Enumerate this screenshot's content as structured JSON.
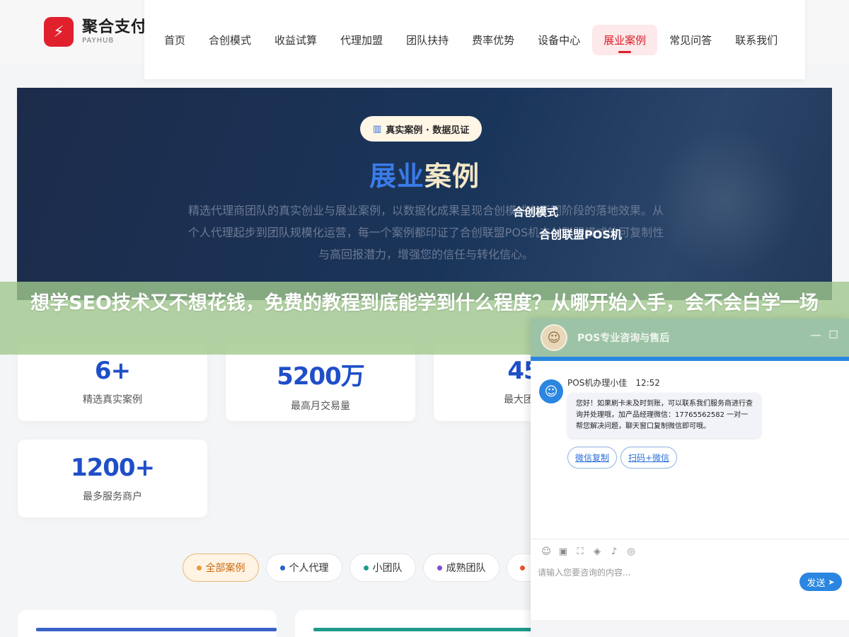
{
  "brand": {
    "name_cn": "聚合支付",
    "name_en": "PAYHUB",
    "logo_glyph": "⚡",
    "color": "#e0202d"
  },
  "nav": {
    "items": [
      {
        "label": "首页"
      },
      {
        "label": "合创模式"
      },
      {
        "label": "收益试算"
      },
      {
        "label": "代理加盟"
      },
      {
        "label": "团队扶持"
      },
      {
        "label": "费率优势"
      },
      {
        "label": "设备中心"
      },
      {
        "label": "展业案例",
        "active": true
      },
      {
        "label": "常见问答"
      },
      {
        "label": "联系我们"
      }
    ]
  },
  "hero": {
    "badge_icon": "chart-icon",
    "badge": "真实案例 · 数据见证",
    "title_part1": "展业",
    "title_part2": "案例",
    "desc": "精选代理商团队的真实创业与展业案例，以数据化成果呈现合创模式在不同阶段的落地效果。从个人代理起步到团队规模化运营，每一个案例都印证了合创联盟POS机支付联盟模式的可复制性与高回报潜力，增强您的信任与转化信心。",
    "tip1": "合创模式",
    "tip2": "合创联盟POS机"
  },
  "overlay": {
    "title": "想学SEO技术又不想花钱，免费的教程到底能学到什么程度？从哪开始入手，会不会白学一场"
  },
  "stats": [
    {
      "value": "6+",
      "label": "精选真实案例"
    },
    {
      "value": "5200万",
      "label": "最高月交易量"
    },
    {
      "value": "45",
      "label": "最大团队"
    },
    {
      "value": "1200+",
      "label": "最多服务商户"
    }
  ],
  "filters": [
    {
      "label": "全部案例",
      "active": true,
      "dot": "#e89a3c"
    },
    {
      "label": "个人代理",
      "dot": "#2f5fd0"
    },
    {
      "label": "小团队",
      "dot": "#1f9a8a"
    },
    {
      "label": "成熟团队",
      "dot": "#7a4fd0"
    },
    {
      "label": "",
      "dot": "#e4572e"
    }
  ],
  "cards": [
    {
      "bar_color": "#3a63c8"
    },
    {
      "bar_color": "#1f9a8a"
    }
  ],
  "chat": {
    "title": "POS专业咨询与售后",
    "minimize": "—",
    "maximize": "☐",
    "agent_name": "POS机办理小佳",
    "time": "12:52",
    "message": "您好！如果刷卡未及时到账，可以联系我们服务商进行查询并处理哦，加产品经理微信：17765562582 一对一帮您解决问题，聊天窗口复制微信即可哦。",
    "quick_replies": [
      "微信复制",
      "扫码+微信"
    ],
    "tools": [
      "smile-icon",
      "image-icon",
      "crop-icon",
      "shield-icon",
      "voice-icon",
      "chat-icon"
    ],
    "input_placeholder": "请输入您要咨询的内容...",
    "send_label": "发送"
  }
}
